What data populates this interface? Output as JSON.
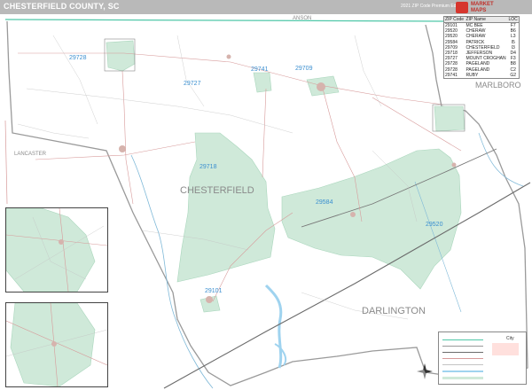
{
  "title": "CHESTERFIELD COUNTY, SC",
  "subtitle": "2021 ZIP Code Premium Edition",
  "logo": {
    "line1": "MARKET",
    "line2": "MAPS"
  },
  "colors": {
    "zip_fill": "#cfe9d9",
    "zip_label": "#3a8fd0",
    "water": "#9fd3ef",
    "county_line": "#4fc7a8",
    "major_road": "#555555",
    "route": "#d46a6a"
  },
  "zip_labels": [
    "29728",
    "29727",
    "29741",
    "29709",
    "29718",
    "29584",
    "29520",
    "29101"
  ],
  "place_labels": {
    "anson": "ANSON",
    "marlboro": "MARLBORO",
    "lancaster": "LANCASTER",
    "chesterfield": "CHESTERFIELD",
    "darlington": "DARLINGTON"
  },
  "zip_table": {
    "headers": [
      "ZIP Code",
      "ZIP Name",
      "LOC"
    ],
    "rows": [
      [
        "29101",
        "MC BEE",
        "F7"
      ],
      [
        "29520",
        "CHERAW",
        "B6"
      ],
      [
        "29520",
        "CHERAW",
        "L3"
      ],
      [
        "29584",
        "PATRICK",
        "I5"
      ],
      [
        "29709",
        "CHESTERFIELD",
        "I3"
      ],
      [
        "29718",
        "JEFFERSON",
        "D4"
      ],
      [
        "29727",
        "MOUNT CROGHAN",
        "F3"
      ],
      [
        "29728",
        "PAGELAND",
        "B8"
      ],
      [
        "29728",
        "PAGELAND",
        "C2"
      ],
      [
        "29741",
        "RUBY",
        "G2"
      ]
    ]
  },
  "scale": {
    "label": "City"
  }
}
